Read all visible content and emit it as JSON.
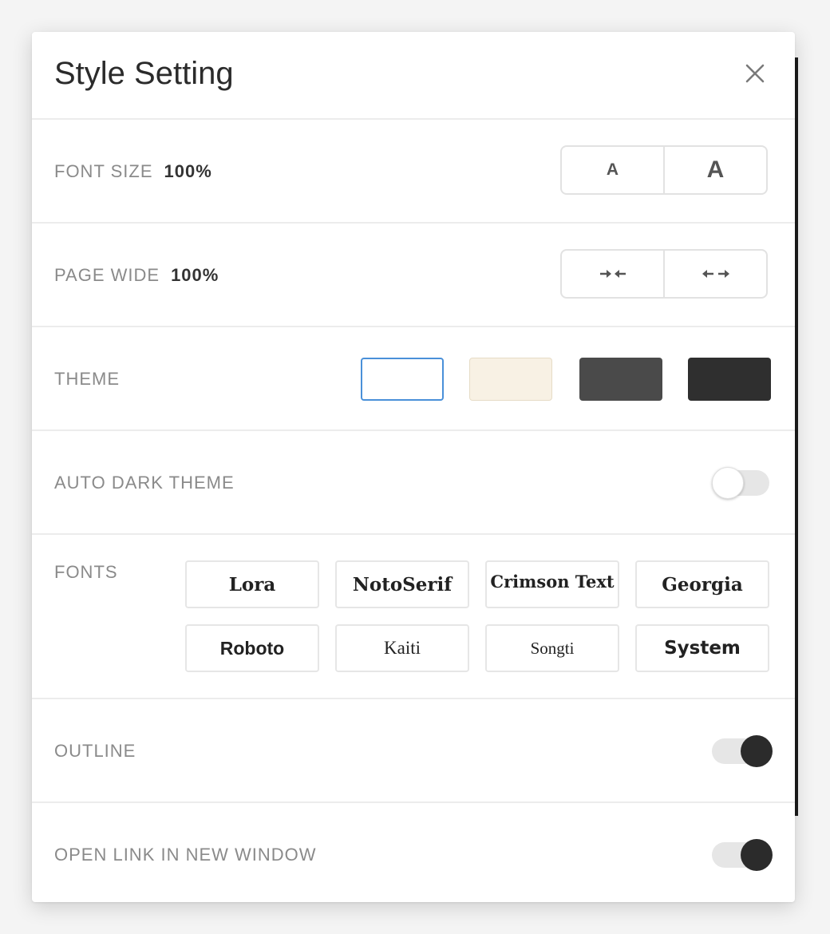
{
  "dialog": {
    "title": "Style Setting"
  },
  "font_size": {
    "label": "FONT SIZE",
    "value": "100%",
    "decrease_label": "A",
    "increase_label": "A"
  },
  "page_wide": {
    "label": "PAGE WIDE",
    "value": "100%",
    "narrow_icon": "arrows-inward-icon",
    "wide_icon": "arrows-outward-icon"
  },
  "theme": {
    "label": "THEME",
    "options": [
      {
        "name": "white",
        "color": "#ffffff",
        "selected": true
      },
      {
        "name": "sepia",
        "color": "#f8f1e4",
        "selected": false
      },
      {
        "name": "gray",
        "color": "#4a4a4a",
        "selected": false
      },
      {
        "name": "dark",
        "color": "#2f2f2f",
        "selected": false
      }
    ],
    "selected_border_color": "#4a90d9"
  },
  "auto_dark_theme": {
    "label": "AUTO DARK THEME",
    "enabled": false
  },
  "fonts": {
    "label": "FONTS",
    "options": [
      "Lora",
      "NotoSerif",
      "Crimson Text",
      "Georgia",
      "Roboto",
      "Kaiti",
      "Songti",
      "System"
    ]
  },
  "outline": {
    "label": "OUTLINE",
    "enabled": true
  },
  "open_link_new_window": {
    "label": "OPEN LINK IN NEW WINDOW",
    "enabled": true
  }
}
